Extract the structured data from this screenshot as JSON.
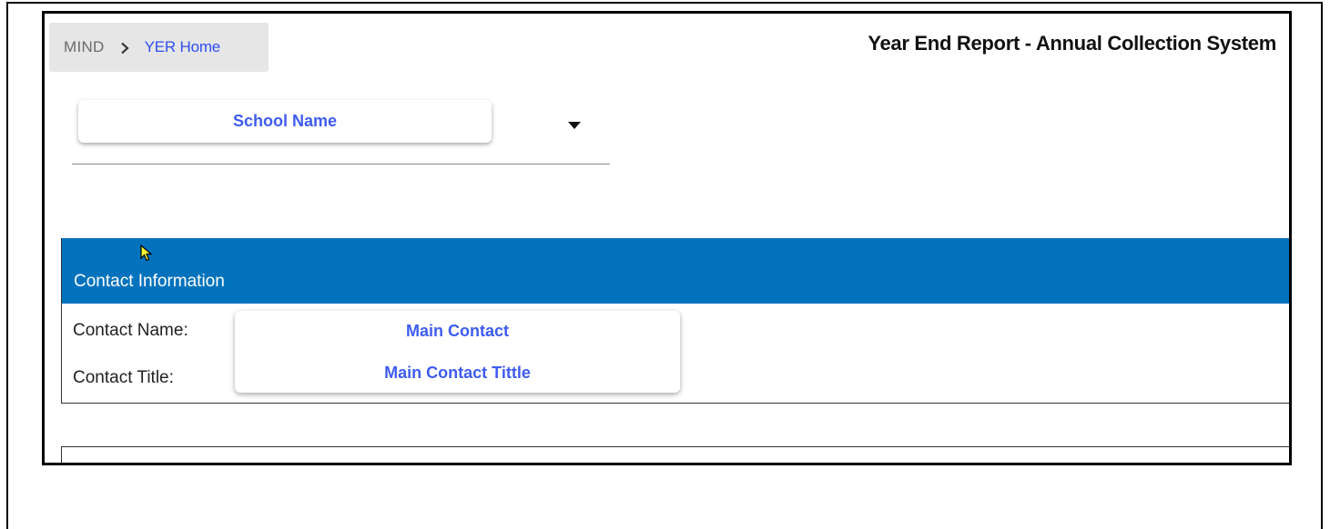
{
  "breadcrumb": {
    "root": "MIND",
    "separator_icon": "chevron-right-icon",
    "current": "YER Home"
  },
  "header": {
    "title": "Year End Report - Annual Collection System"
  },
  "school_select": {
    "value": "School Name",
    "icon": "caret-down-icon"
  },
  "contact_section": {
    "header": "Contact Information",
    "fields": [
      {
        "label": "Contact Name:",
        "value": "Main Contact"
      },
      {
        "label": "Contact Title:",
        "value": "Main Contact Tittle"
      }
    ]
  },
  "colors": {
    "section_header_bg": "#0272bd",
    "link_blue": "#2f4ef0",
    "value_blue": "#3e5cf0",
    "breadcrumb_bg": "#e6e6e6"
  }
}
